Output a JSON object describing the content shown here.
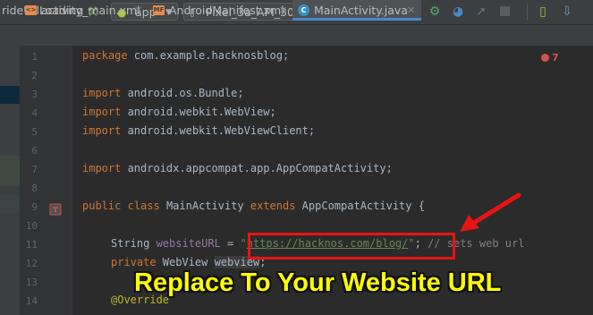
{
  "toolbar": {
    "project_text": "rideUrlLoading",
    "module_label": "app",
    "device_label": "Pixel_3a_API_30_x86",
    "icons": [
      "hammer-icon",
      "android-icon",
      "run-icon",
      "apply-changes-icon",
      "apply-code-changes-icon",
      "debug-icon",
      "profile-icon",
      "attach-debugger-icon",
      "stop-icon",
      "device-manager-icon",
      "sdk-manager-icon"
    ]
  },
  "tabs": [
    {
      "label": "activity_main.xml",
      "file_badge": "<>"
    },
    {
      "label": "AndroidManifest.xml",
      "file_badge": "MF"
    },
    {
      "label": "MainActivity.java",
      "file_badge": "C",
      "active": true
    }
  ],
  "editor": {
    "error_count": "7",
    "line_numbers": [
      "1",
      "2",
      "3",
      "4",
      "5",
      "6",
      "7",
      "8",
      "9",
      "10",
      "11",
      "12",
      "13",
      "14"
    ],
    "lines": [
      {
        "kw": "package",
        "rest": " com.example.hacknosblog;"
      },
      {
        "kw": "import",
        "rest": " android.os.Bundle;"
      },
      {
        "kw": "import",
        "rest": " android.webkit.WebView;"
      },
      {
        "kw": "import",
        "rest": " android.webkit.WebViewClient;"
      },
      {
        "kw": "import",
        "rest": " androidx.appcompat.app.AppCompatActivity;"
      }
    ],
    "class_line": {
      "kw1": "public",
      "kw2": "class",
      "name": " MainActivity ",
      "kw3": "extends",
      "rest": " AppCompatActivity {"
    },
    "url_line": {
      "type": "String ",
      "field": "websiteURL",
      "eq": " = ",
      "q1": "\"",
      "url": "https://hacknos.com/blog/",
      "q2": "\"",
      "semi": ";",
      "comment": " // sets web url"
    },
    "webview_line": {
      "kw": "private",
      "rest": " WebView ",
      "field": "webview",
      "semi": ";"
    },
    "annotation": "@Override"
  },
  "caption": "Replace To Your Website URL",
  "colors": {
    "highlight_box": "#e81414",
    "caption": "#ffff00",
    "accent_tab": "#4a88c7"
  }
}
